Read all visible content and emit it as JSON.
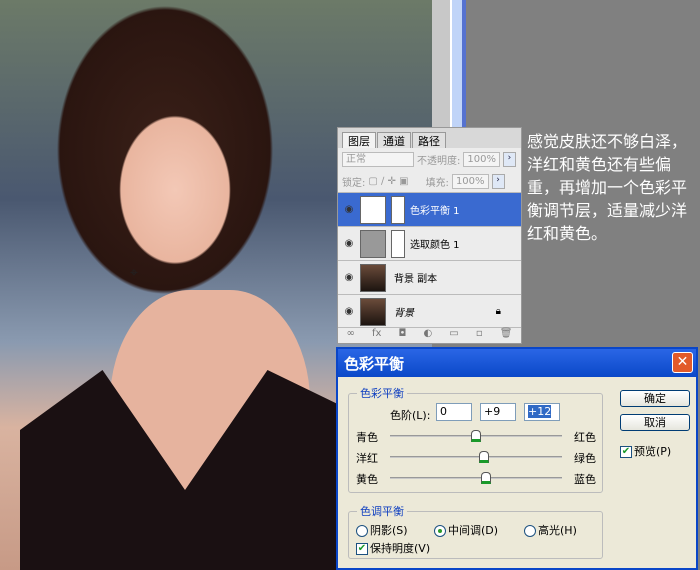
{
  "note": "感觉皮肤还不够白泽，洋红和黄色还有些偏重，再增加一个色彩平衡调节层，适量减少洋红和黄色。",
  "layers_panel": {
    "tabs": [
      "图层",
      "通道",
      "路径"
    ],
    "blend_mode": "正常",
    "opacity_label": "不透明度:",
    "opacity": "100%",
    "lock_label": "锁定:",
    "fill_label": "填充:",
    "fill": "100%",
    "layers": [
      {
        "name": "色彩平衡 1",
        "selected": true
      },
      {
        "name": "选取颜色 1"
      },
      {
        "name": "背景 副本"
      },
      {
        "name": "背景",
        "locked": true
      }
    ]
  },
  "dialog": {
    "title": "色彩平衡",
    "close": "✕",
    "group1": "色彩平衡",
    "levels_label": "色阶(L):",
    "levels": [
      "0",
      "+9",
      "+12"
    ],
    "sliders": [
      {
        "left": "青色",
        "right": "红色",
        "value": 0
      },
      {
        "left": "洋红",
        "right": "绿色",
        "value": 9
      },
      {
        "left": "黄色",
        "right": "蓝色",
        "value": 12
      }
    ],
    "ok": "确定",
    "cancel": "取消",
    "preview": "预览(P)",
    "group2": "色调平衡",
    "tones": [
      "阴影(S)",
      "中间调(D)",
      "高光(H)"
    ],
    "selected_tone": 1,
    "preserve": "保持明度(V)"
  }
}
